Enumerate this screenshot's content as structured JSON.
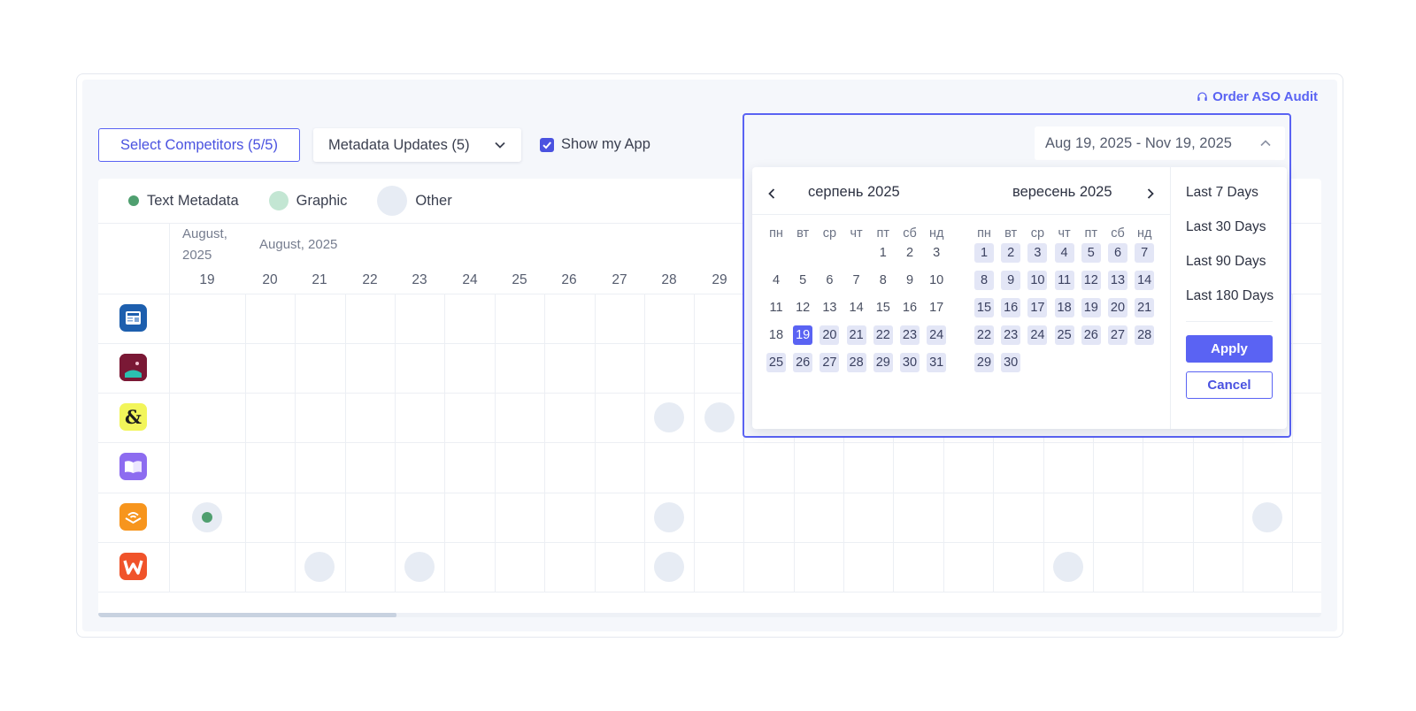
{
  "header": {
    "order_link": "Order ASO Audit"
  },
  "toolbar": {
    "competitors_label": "Select Competitors (5/5)",
    "metadata_label": "Metadata Updates (5)",
    "show_my_app_label": "Show my App",
    "show_my_app_checked": true
  },
  "legend": {
    "text_metadata": "Text Metadata",
    "graphic": "Graphic",
    "other": "Other"
  },
  "timeline": {
    "first_month": "August,",
    "first_year": "2025",
    "month_label": "August, 2025",
    "days": [
      "19",
      "20",
      "21",
      "22",
      "23",
      "24",
      "25",
      "26",
      "27",
      "28",
      "29"
    ]
  },
  "apps": [
    {
      "icon": "news-app-icon",
      "color": "#1d5fae"
    },
    {
      "icon": "books-app-icon",
      "color": "#8a1d3a"
    },
    {
      "icon": "ampersand-app-icon",
      "color": "#f2f55a"
    },
    {
      "icon": "book-open-app-icon",
      "color": "#8d6cf0"
    },
    {
      "icon": "audible-app-icon",
      "color": "#f7951d"
    },
    {
      "icon": "w-app-icon",
      "color": "#f0532a"
    }
  ],
  "datepicker": {
    "range_value": "Aug 19, 2025 - Nov 19, 2025",
    "left_month": "серпень 2025",
    "right_month": "вересень 2025",
    "weekdays": [
      "пн",
      "вт",
      "ср",
      "чт",
      "пт",
      "сб",
      "нд"
    ],
    "left_days": [
      [
        "",
        "",
        "",
        "",
        "1",
        "2",
        "3"
      ],
      [
        "4",
        "5",
        "6",
        "7",
        "8",
        "9",
        "10"
      ],
      [
        "11",
        "12",
        "13",
        "14",
        "15",
        "16",
        "17"
      ],
      [
        "18",
        "19",
        "20",
        "21",
        "22",
        "23",
        "24"
      ],
      [
        "25",
        "26",
        "27",
        "28",
        "29",
        "30",
        "31"
      ]
    ],
    "right_days": [
      [
        "1",
        "2",
        "3",
        "4",
        "5",
        "6",
        "7"
      ],
      [
        "8",
        "9",
        "10",
        "11",
        "12",
        "13",
        "14"
      ],
      [
        "15",
        "16",
        "17",
        "18",
        "19",
        "20",
        "21"
      ],
      [
        "22",
        "23",
        "24",
        "25",
        "26",
        "27",
        "28"
      ],
      [
        "29",
        "30",
        "",
        "",
        "",
        "",
        ""
      ]
    ],
    "selected_start": "19",
    "presets": [
      "Last 7 Days",
      "Last 30 Days",
      "Last 90 Days",
      "Last 180 Days"
    ],
    "apply_label": "Apply",
    "cancel_label": "Cancel"
  },
  "colors": {
    "accent": "#5a63f3",
    "text_metadata": "#4f9f6f",
    "graphic": "#c3e6d3",
    "other": "#e7ecf4",
    "range": "#e3e6f6"
  }
}
